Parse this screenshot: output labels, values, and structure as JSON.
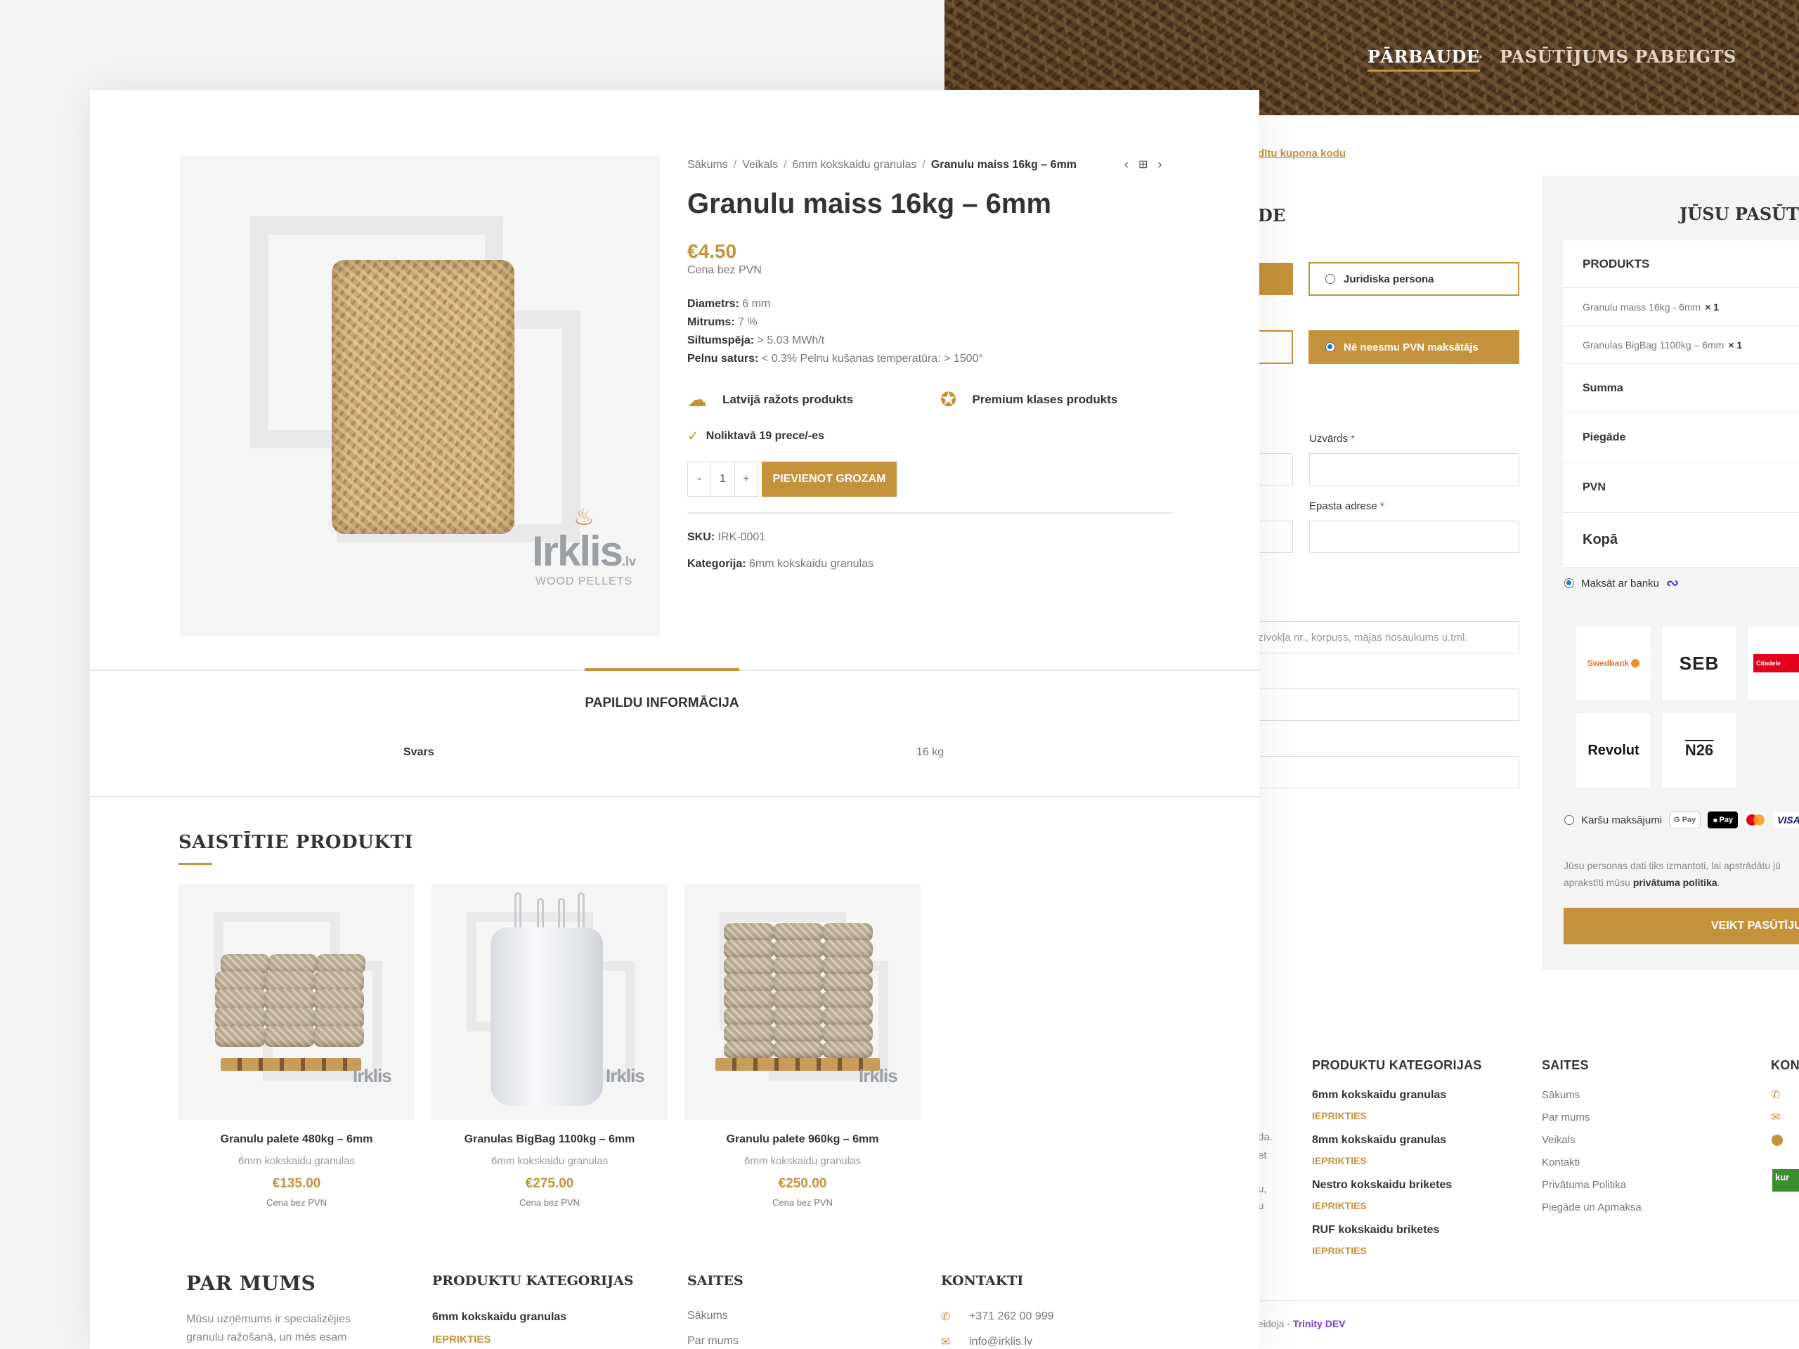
{
  "checkout": {
    "hero": {
      "step_current": "PĀRBAUDE",
      "arrow": "→",
      "step_next": "PASŪTĪJUMS PABEIGTS"
    },
    "coupon_link": "dītu kupona kodu",
    "billing_title_fragment": "DE",
    "person_type": {
      "option_legal": "Juridiska persona"
    },
    "vat": {
      "option_not_vat_payer": "Nē neesmu PVN maksātājs"
    },
    "fields": {
      "last_name_label": "Uzvārds",
      "email_label": "Epasta adrese",
      "required_mark": "*",
      "address2_placeholder": "zīvokļa nr., korpuss, mājas nosaukums u.tml."
    },
    "order": {
      "title": "JŪSU PASŪTĪJ",
      "head_product": "PRODUKTS",
      "items": [
        {
          "name": "Granulu maiss 16kg - 6mm",
          "qty": "× 1"
        },
        {
          "name": "Granulas BigBag 1100kg – 6mm",
          "qty": "× 1"
        }
      ],
      "row_sum": "Summa",
      "row_shipping": "Piegāde",
      "row_vat": "PVN",
      "row_total": "Kopā"
    },
    "payment": {
      "bank_option": "Maksāt ar banku",
      "banks": [
        "Swedbank",
        "SEB",
        "Citadele",
        "Revolut",
        "N26"
      ],
      "card_option": "Karšu maksājumi",
      "card_brands": [
        "G Pay",
        "Pay",
        "VISA"
      ]
    },
    "privacy": {
      "text_line1": "Jūsu personas dati tiks izmantoti, lai apstrādātu jū",
      "text_line2": "aprakstīti mūsu",
      "link": "privātuma politika",
      "dot": "."
    },
    "place_order": "VEIKT PASŪTĪJUM",
    "footer": {
      "categories_heading": "PRODUKTU KATEGORIJAS",
      "categories": [
        {
          "name": "6mm kokskaidu granulas",
          "badge": "IEPRIKTIES"
        },
        {
          "name": "8mm kokskaidu granulas",
          "badge": "IEPRIKTIES"
        },
        {
          "name": "Nestro kokskaidu briketes",
          "badge": "IEPRIKTIES"
        },
        {
          "name": "RUF kokskaidu briketes",
          "badge": "IEPRIKTIES"
        }
      ],
      "links_heading": "SAITES",
      "links": [
        "Sākums",
        "Par mums",
        "Veikals",
        "Kontakti",
        "Privātuma Politika",
        "Piegāde un Apmaksa"
      ],
      "contacts_heading": "KONT",
      "about_fragments": [
        "da.",
        "et",
        "u,",
        "u"
      ],
      "credit_prefix": "eidoja -",
      "credit_name": "Trinity DEV",
      "badge_text": "kur"
    }
  },
  "product": {
    "breadcrumb": [
      "Sākums",
      "Veikals",
      "6mm kokskaidu granulas"
    ],
    "breadcrumb_sep": "/",
    "breadcrumb_current": "Granulu maiss 16kg – 6mm",
    "title": "Granulu maiss 16kg – 6mm",
    "price": "€4.50",
    "price_note": "Cena bez PVN",
    "attributes": [
      {
        "label": "Diametrs:",
        "value": "6 mm"
      },
      {
        "label": "Mitrums:",
        "value": "7 %"
      },
      {
        "label": "Siltumspēja:",
        "value": "> 5.03 MWh/t"
      },
      {
        "label": "Pelnu saturs:",
        "value": "< 0.3% Pelnu kušanas temperatūra: > 1500°"
      }
    ],
    "features": [
      "Latvijā ražots produkts",
      "Premium klases produkts"
    ],
    "stock": "Noliktavā 19 prece/-es",
    "quantity": {
      "minus": "-",
      "value": "1",
      "plus": "+"
    },
    "add_to_cart": "PIEVIENOT GROZAM",
    "sku_label": "SKU:",
    "sku": "IRK-0001",
    "category_label": "Kategorija:",
    "category": "6mm kokskaidu granulas",
    "image_logo": {
      "name": "Irklis",
      "tld": ".lv",
      "tagline": "WOOD PELLETS"
    },
    "tab": "PAPILDU INFORMĀCIJA",
    "specs": [
      {
        "key": "Svars",
        "value": "16 kg"
      }
    ]
  },
  "related": {
    "title": "SAISTĪTIE PRODUKTI",
    "items": [
      {
        "name": "Granulu palete 480kg – 6mm",
        "category": "6mm kokskaidu granulas",
        "price": "€135.00",
        "note": "Cena bez PVN",
        "logo": "Irklis"
      },
      {
        "name": "Granulas BigBag 1100kg – 6mm",
        "category": "6mm kokskaidu granulas",
        "price": "€275.00",
        "note": "Cena bez PVN",
        "logo": "Irklis"
      },
      {
        "name": "Granulu palete 960kg – 6mm",
        "category": "6mm kokskaidu granulas",
        "price": "€250.00",
        "note": "Cena bez PVN",
        "logo": "Irklis"
      }
    ]
  },
  "footer": {
    "about_heading": "PAR MUMS",
    "about_lines": [
      "Mūsu uzņēmums ir specializējies",
      "granulu ražošanā, un mēs esam"
    ],
    "categories_heading": "PRODUKTU KATEGORIJAS",
    "first_category": "6mm kokskaidu granulas",
    "first_badge": "IEPRIKTIES",
    "links_heading": "SAITES",
    "links": [
      "Sākums",
      "Par mums"
    ],
    "contacts_heading": "KONTAKTI",
    "phone": "+371 262 00 999",
    "email": "info@irklis.lv"
  }
}
